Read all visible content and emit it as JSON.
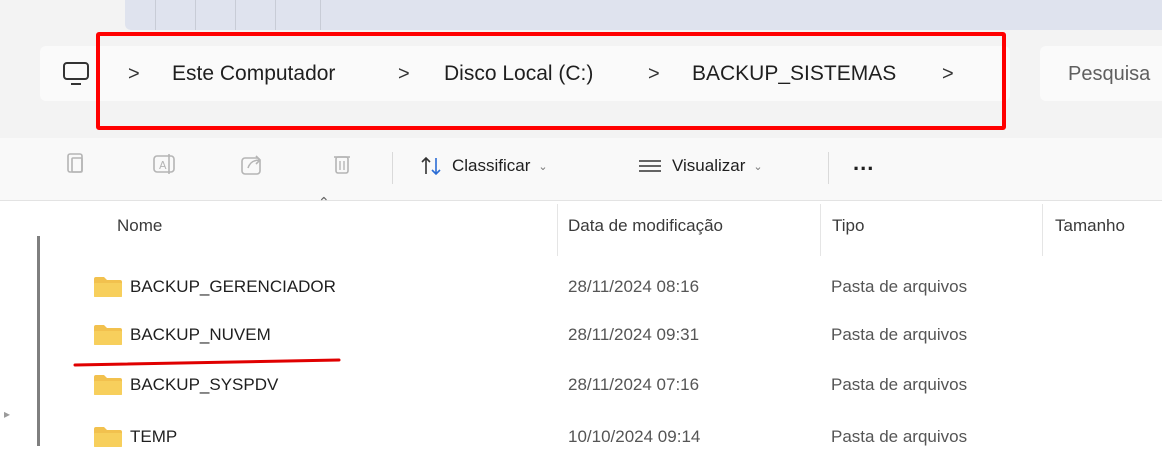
{
  "breadcrumb": {
    "items": [
      "Este Computador",
      "Disco Local (C:)",
      "BACKUP_SISTEMAS"
    ],
    "separator": ">"
  },
  "search": {
    "placeholder": "Pesquisa"
  },
  "toolbar": {
    "sort_label": "Classificar",
    "view_label": "Visualizar",
    "more_label": "..."
  },
  "columns": {
    "name": "Nome",
    "date": "Data de modificação",
    "type": "Tipo",
    "size": "Tamanho"
  },
  "files": [
    {
      "name": "BACKUP_GERENCIADOR",
      "date": "28/11/2024 08:16",
      "type": "Pasta de arquivos"
    },
    {
      "name": "BACKUP_NUVEM",
      "date": "28/11/2024 09:31",
      "type": "Pasta de arquivos"
    },
    {
      "name": "BACKUP_SYSPDV",
      "date": "28/11/2024 07:16",
      "type": "Pasta de arquivos"
    },
    {
      "name": "TEMP",
      "date": "10/10/2024 09:14",
      "type": "Pasta de arquivos"
    }
  ],
  "colors": {
    "highlight": "#ff0000",
    "folder": "#f2c14e"
  }
}
